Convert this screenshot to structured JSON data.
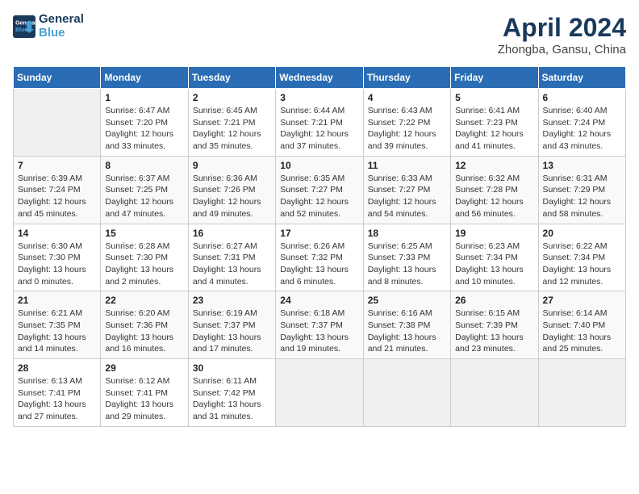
{
  "header": {
    "logo_line1": "General",
    "logo_line2": "Blue",
    "month_year": "April 2024",
    "location": "Zhongba, Gansu, China"
  },
  "days_of_week": [
    "Sunday",
    "Monday",
    "Tuesday",
    "Wednesday",
    "Thursday",
    "Friday",
    "Saturday"
  ],
  "weeks": [
    [
      {
        "day": "",
        "sunrise": "",
        "sunset": "",
        "daylight": ""
      },
      {
        "day": "1",
        "sunrise": "Sunrise: 6:47 AM",
        "sunset": "Sunset: 7:20 PM",
        "daylight": "Daylight: 12 hours and 33 minutes."
      },
      {
        "day": "2",
        "sunrise": "Sunrise: 6:45 AM",
        "sunset": "Sunset: 7:21 PM",
        "daylight": "Daylight: 12 hours and 35 minutes."
      },
      {
        "day": "3",
        "sunrise": "Sunrise: 6:44 AM",
        "sunset": "Sunset: 7:21 PM",
        "daylight": "Daylight: 12 hours and 37 minutes."
      },
      {
        "day": "4",
        "sunrise": "Sunrise: 6:43 AM",
        "sunset": "Sunset: 7:22 PM",
        "daylight": "Daylight: 12 hours and 39 minutes."
      },
      {
        "day": "5",
        "sunrise": "Sunrise: 6:41 AM",
        "sunset": "Sunset: 7:23 PM",
        "daylight": "Daylight: 12 hours and 41 minutes."
      },
      {
        "day": "6",
        "sunrise": "Sunrise: 6:40 AM",
        "sunset": "Sunset: 7:24 PM",
        "daylight": "Daylight: 12 hours and 43 minutes."
      }
    ],
    [
      {
        "day": "7",
        "sunrise": "Sunrise: 6:39 AM",
        "sunset": "Sunset: 7:24 PM",
        "daylight": "Daylight: 12 hours and 45 minutes."
      },
      {
        "day": "8",
        "sunrise": "Sunrise: 6:37 AM",
        "sunset": "Sunset: 7:25 PM",
        "daylight": "Daylight: 12 hours and 47 minutes."
      },
      {
        "day": "9",
        "sunrise": "Sunrise: 6:36 AM",
        "sunset": "Sunset: 7:26 PM",
        "daylight": "Daylight: 12 hours and 49 minutes."
      },
      {
        "day": "10",
        "sunrise": "Sunrise: 6:35 AM",
        "sunset": "Sunset: 7:27 PM",
        "daylight": "Daylight: 12 hours and 52 minutes."
      },
      {
        "day": "11",
        "sunrise": "Sunrise: 6:33 AM",
        "sunset": "Sunset: 7:27 PM",
        "daylight": "Daylight: 12 hours and 54 minutes."
      },
      {
        "day": "12",
        "sunrise": "Sunrise: 6:32 AM",
        "sunset": "Sunset: 7:28 PM",
        "daylight": "Daylight: 12 hours and 56 minutes."
      },
      {
        "day": "13",
        "sunrise": "Sunrise: 6:31 AM",
        "sunset": "Sunset: 7:29 PM",
        "daylight": "Daylight: 12 hours and 58 minutes."
      }
    ],
    [
      {
        "day": "14",
        "sunrise": "Sunrise: 6:30 AM",
        "sunset": "Sunset: 7:30 PM",
        "daylight": "Daylight: 13 hours and 0 minutes."
      },
      {
        "day": "15",
        "sunrise": "Sunrise: 6:28 AM",
        "sunset": "Sunset: 7:30 PM",
        "daylight": "Daylight: 13 hours and 2 minutes."
      },
      {
        "day": "16",
        "sunrise": "Sunrise: 6:27 AM",
        "sunset": "Sunset: 7:31 PM",
        "daylight": "Daylight: 13 hours and 4 minutes."
      },
      {
        "day": "17",
        "sunrise": "Sunrise: 6:26 AM",
        "sunset": "Sunset: 7:32 PM",
        "daylight": "Daylight: 13 hours and 6 minutes."
      },
      {
        "day": "18",
        "sunrise": "Sunrise: 6:25 AM",
        "sunset": "Sunset: 7:33 PM",
        "daylight": "Daylight: 13 hours and 8 minutes."
      },
      {
        "day": "19",
        "sunrise": "Sunrise: 6:23 AM",
        "sunset": "Sunset: 7:34 PM",
        "daylight": "Daylight: 13 hours and 10 minutes."
      },
      {
        "day": "20",
        "sunrise": "Sunrise: 6:22 AM",
        "sunset": "Sunset: 7:34 PM",
        "daylight": "Daylight: 13 hours and 12 minutes."
      }
    ],
    [
      {
        "day": "21",
        "sunrise": "Sunrise: 6:21 AM",
        "sunset": "Sunset: 7:35 PM",
        "daylight": "Daylight: 13 hours and 14 minutes."
      },
      {
        "day": "22",
        "sunrise": "Sunrise: 6:20 AM",
        "sunset": "Sunset: 7:36 PM",
        "daylight": "Daylight: 13 hours and 16 minutes."
      },
      {
        "day": "23",
        "sunrise": "Sunrise: 6:19 AM",
        "sunset": "Sunset: 7:37 PM",
        "daylight": "Daylight: 13 hours and 17 minutes."
      },
      {
        "day": "24",
        "sunrise": "Sunrise: 6:18 AM",
        "sunset": "Sunset: 7:37 PM",
        "daylight": "Daylight: 13 hours and 19 minutes."
      },
      {
        "day": "25",
        "sunrise": "Sunrise: 6:16 AM",
        "sunset": "Sunset: 7:38 PM",
        "daylight": "Daylight: 13 hours and 21 minutes."
      },
      {
        "day": "26",
        "sunrise": "Sunrise: 6:15 AM",
        "sunset": "Sunset: 7:39 PM",
        "daylight": "Daylight: 13 hours and 23 minutes."
      },
      {
        "day": "27",
        "sunrise": "Sunrise: 6:14 AM",
        "sunset": "Sunset: 7:40 PM",
        "daylight": "Daylight: 13 hours and 25 minutes."
      }
    ],
    [
      {
        "day": "28",
        "sunrise": "Sunrise: 6:13 AM",
        "sunset": "Sunset: 7:41 PM",
        "daylight": "Daylight: 13 hours and 27 minutes."
      },
      {
        "day": "29",
        "sunrise": "Sunrise: 6:12 AM",
        "sunset": "Sunset: 7:41 PM",
        "daylight": "Daylight: 13 hours and 29 minutes."
      },
      {
        "day": "30",
        "sunrise": "Sunrise: 6:11 AM",
        "sunset": "Sunset: 7:42 PM",
        "daylight": "Daylight: 13 hours and 31 minutes."
      },
      {
        "day": "",
        "sunrise": "",
        "sunset": "",
        "daylight": ""
      },
      {
        "day": "",
        "sunrise": "",
        "sunset": "",
        "daylight": ""
      },
      {
        "day": "",
        "sunrise": "",
        "sunset": "",
        "daylight": ""
      },
      {
        "day": "",
        "sunrise": "",
        "sunset": "",
        "daylight": ""
      }
    ]
  ]
}
